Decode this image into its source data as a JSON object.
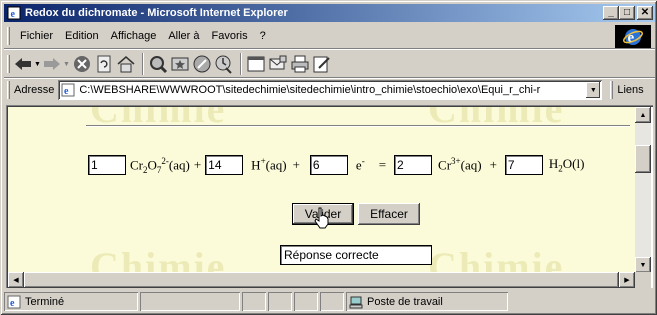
{
  "window": {
    "title": "Redox du dichromate - Microsoft Internet Explorer"
  },
  "menu": {
    "items": [
      "Fichier",
      "Edition",
      "Affichage",
      "Aller à",
      "Favoris",
      "?"
    ]
  },
  "address": {
    "label": "Adresse",
    "url": "C:\\WEBSHARE\\WWWROOT\\sitedechimie\\sitedechimie\\intro_chimie\\stoechio\\exo\\Equi_r_chi-r",
    "links_label": "Liens"
  },
  "page": {
    "watermark": "Chimie",
    "equation": {
      "coef1": "1",
      "coef2": "14",
      "coef3": "6",
      "coef4": "2",
      "coef5": "7",
      "plus": "+",
      "equals": "="
    },
    "validate_label": "Valider",
    "clear_label": "Effacer",
    "result_value": "Réponse correcte"
  },
  "status": {
    "left": "Terminé",
    "zone": "Poste de travail"
  },
  "colors": {
    "titlebar_start": "#0a246a",
    "titlebar_end": "#a6caf0",
    "page_bg": "#fbfbd9"
  }
}
